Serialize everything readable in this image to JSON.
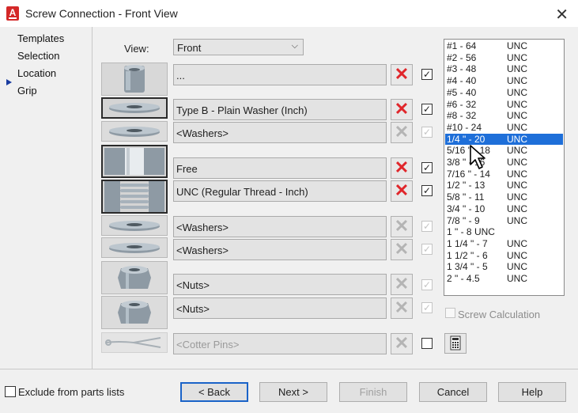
{
  "window": {
    "title": "Screw Connection - Front View",
    "app_icon_letter": "A"
  },
  "nav": {
    "items": [
      "Templates",
      "Selection",
      "Location",
      "Grip"
    ],
    "active": "Selection"
  },
  "view": {
    "label": "View:",
    "value": "Front"
  },
  "rows": [
    {
      "name": "screw-head",
      "value": "...",
      "enabled": true,
      "checked": true,
      "thumb": "screw-head"
    },
    {
      "name": "washer-1",
      "value": "Type B - Plain Washer (Inch)",
      "enabled": true,
      "checked": true,
      "thumb": "washer"
    },
    {
      "name": "washer-2",
      "value": "<Washers>",
      "enabled": false,
      "checked": true,
      "thumb": "washer"
    },
    {
      "name": "hole-free",
      "value": "Free",
      "enabled": true,
      "checked": true,
      "thumb": "hole"
    },
    {
      "name": "hole-thread",
      "value": "UNC (Regular Thread - Inch)",
      "enabled": true,
      "checked": true,
      "thumb": "thread"
    },
    {
      "name": "washer-3",
      "value": "<Washers>",
      "enabled": false,
      "checked": true,
      "thumb": "washer"
    },
    {
      "name": "washer-4",
      "value": "<Washers>",
      "enabled": false,
      "checked": true,
      "thumb": "washer"
    },
    {
      "name": "nut-1",
      "value": "<Nuts>",
      "enabled": false,
      "checked": true,
      "thumb": "nut"
    },
    {
      "name": "nut-2",
      "value": "<Nuts>",
      "enabled": false,
      "checked": true,
      "thumb": "nut"
    },
    {
      "name": "cotter-pin",
      "value": "<Cotter Pins>",
      "enabled": false,
      "checked": false,
      "thumb": "pin",
      "disabled_text": true
    }
  ],
  "thread_list": {
    "selected_index": 8,
    "items": [
      [
        "#1 - 64",
        "UNC"
      ],
      [
        "#2 - 56",
        "UNC"
      ],
      [
        "#3 - 48",
        "UNC"
      ],
      [
        "#4 - 40",
        "UNC"
      ],
      [
        "#5 - 40",
        "UNC"
      ],
      [
        "#6 - 32",
        "UNC"
      ],
      [
        "#8 - 32",
        "UNC"
      ],
      [
        "#10 - 24",
        "UNC"
      ],
      [
        "1/4 \" - 20",
        "UNC"
      ],
      [
        "5/16 \" - 18",
        "UNC"
      ],
      [
        "3/8 \" - 16",
        "UNC"
      ],
      [
        "7/16 \" - 14",
        "UNC"
      ],
      [
        "1/2 \" - 13",
        "UNC"
      ],
      [
        "5/8 \" - 11",
        "UNC"
      ],
      [
        "3/4 \" - 10",
        "UNC"
      ],
      [
        "7/8 \" - 9",
        "UNC"
      ],
      [
        "1 \" - 8  UNC",
        ""
      ],
      [
        "1 1/4 \" - 7",
        "UNC"
      ],
      [
        "1 1/2 \" - 6",
        "UNC"
      ],
      [
        "1 3/4 \" - 5",
        "UNC"
      ],
      [
        "2 \" - 4.5",
        "UNC"
      ]
    ]
  },
  "screw_calculation": {
    "label": "Screw Calculation",
    "checked": false,
    "enabled": false
  },
  "exclude": {
    "label": "Exclude from parts lists",
    "checked": false
  },
  "buttons": {
    "back": "< Back",
    "next": "Next >",
    "finish": "Finish",
    "cancel": "Cancel",
    "help": "Help"
  },
  "colors": {
    "delete_active": "#e0262b",
    "delete_inactive": "#b4b4b4",
    "selection": "#1e6fd9",
    "primary_border": "#1a63c8"
  }
}
